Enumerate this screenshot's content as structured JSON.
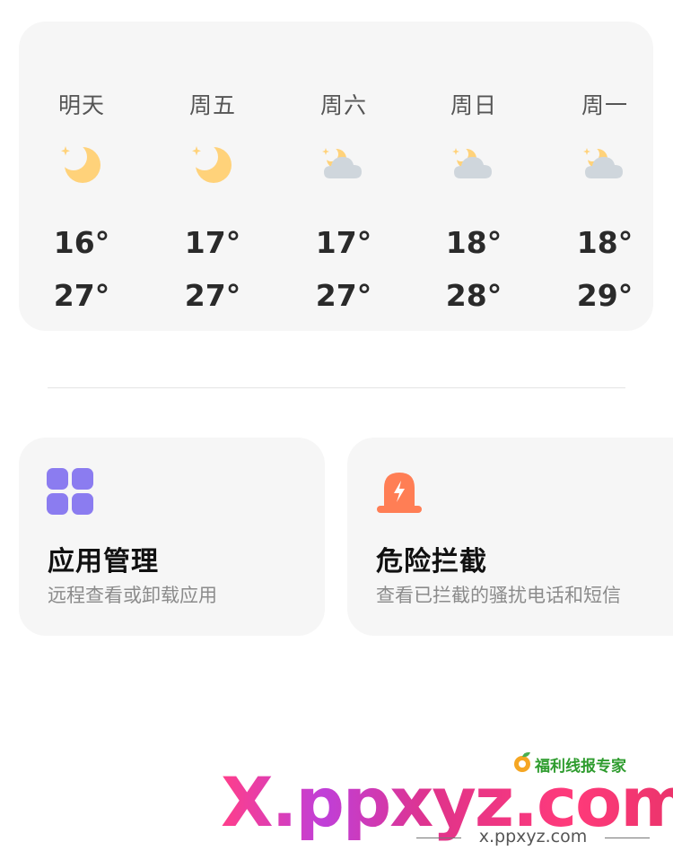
{
  "forecast": {
    "days": [
      {
        "name": "明天",
        "icon": "moon-stars-icon",
        "low": "16°",
        "high": "27°"
      },
      {
        "name": "周五",
        "icon": "moon-stars-icon",
        "low": "17°",
        "high": "27°"
      },
      {
        "name": "周六",
        "icon": "partly-cloudy-icon",
        "low": "17°",
        "high": "27°"
      },
      {
        "name": "周日",
        "icon": "partly-cloudy-icon",
        "low": "18°",
        "high": "28°"
      },
      {
        "name": "周一",
        "icon": "partly-cloudy-icon",
        "low": "18°",
        "high": "29°"
      }
    ]
  },
  "tiles": {
    "app_manage": {
      "title": "应用管理",
      "desc": "远程查看或卸载应用",
      "icon": "grid-apps-icon",
      "icon_color": "#8b7cf0"
    },
    "block": {
      "title": "危险拦截",
      "desc": "查看已拦截的骚扰电话和短信",
      "icon": "alarm-light-icon",
      "icon_color": "#ff7e55"
    }
  },
  "watermark": {
    "brand": "福利线报专家",
    "main": "X.ppxyz.com",
    "sub": "x.ppxyz.com"
  },
  "colors": {
    "card_bg": "#f6f6f6",
    "moon": "#ffd27a",
    "cloud": "#cfd6dc"
  }
}
